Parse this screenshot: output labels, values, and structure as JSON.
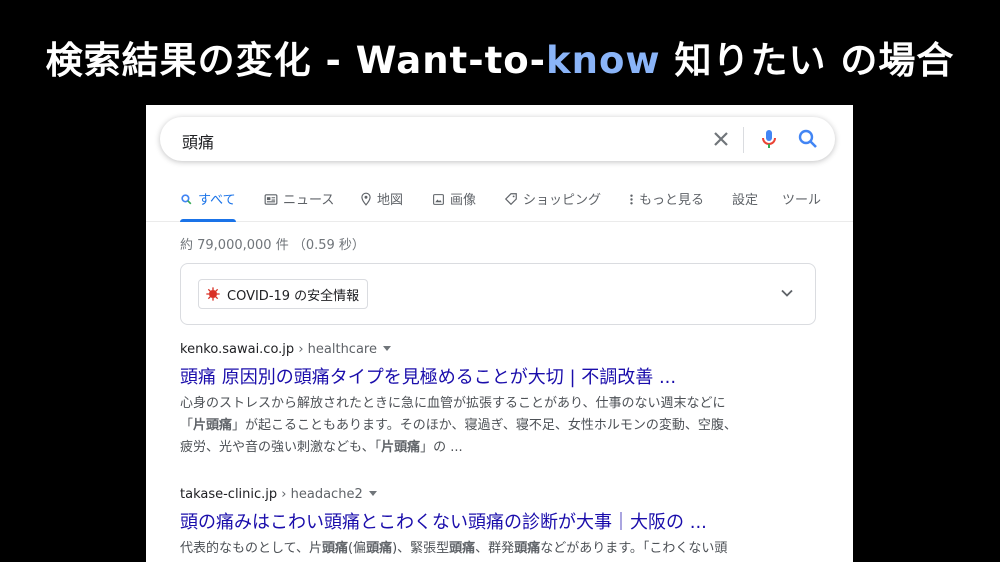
{
  "slide": {
    "title_part1": "検索結果の変化 - Want-to-",
    "title_highlight": "know",
    "title_part2": " 知りたい の場合",
    "highlight_color": "#8ab4f8"
  },
  "search": {
    "query": "頭痛",
    "icons": [
      "close-icon",
      "mic-icon",
      "search-icon"
    ]
  },
  "tabs": [
    {
      "label": "すべて",
      "icon": "search-icon",
      "active": true
    },
    {
      "label": "ニュース",
      "icon": "news-icon"
    },
    {
      "label": "地図",
      "icon": "map-pin-icon"
    },
    {
      "label": "画像",
      "icon": "image-icon"
    },
    {
      "label": "ショッピング",
      "icon": "tag-icon"
    },
    {
      "label": "もっと見る",
      "icon": "more-vert-icon"
    },
    {
      "label": "設定"
    },
    {
      "label": "ツール"
    }
  ],
  "stats": "約 79,000,000 件 （0.59 秒）",
  "covid": {
    "label": "COVID-19 の安全情報",
    "icon": "virus-icon"
  },
  "results": [
    {
      "domain": "kenko.sawai.co.jp",
      "path": " › healthcare",
      "title": "頭痛 原因別の頭痛タイプを見極めることが大切 | 不調改善 ...",
      "snippet_lines": [
        [
          "心身のストレスから解放されたときに急に血管が拡張することがあり、仕事のない週末などに"
        ],
        [
          "「",
          {
            "b": "片頭痛"
          },
          "」が起こることもあります。そのほか、寝過ぎ、寝不足、女性ホルモンの変動、空腹、"
        ],
        [
          "疲労、光や音の強い刺激なども、「",
          {
            "b": "片頭痛"
          },
          "」の ..."
        ]
      ]
    },
    {
      "domain": "takase-clinic.jp",
      "path": " › headache2",
      "title": "頭の痛みはこわい頭痛とこわくない頭痛の診断が大事｜大阪の ...",
      "snippet_lines": [
        [
          "代表的なものとして、片",
          {
            "b": "頭痛"
          },
          "(偏",
          {
            "b": "頭痛"
          },
          ")、緊張型",
          {
            "b": "頭痛"
          },
          "、群発",
          {
            "b": "頭痛"
          },
          "などがあります。「こわくない頭"
        ]
      ]
    }
  ],
  "colors": {
    "link": "#1a0dab",
    "accent": "#1a73e8",
    "mic_blue": "#4285f4",
    "mic_red": "#ea4335"
  }
}
